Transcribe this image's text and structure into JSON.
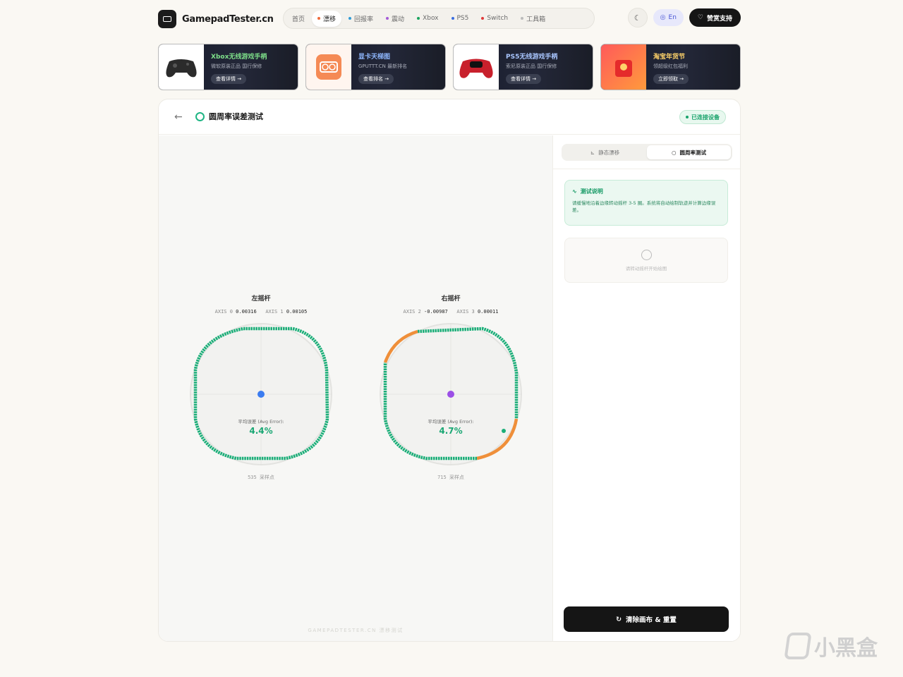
{
  "site": {
    "name": "GamepadTester.cn"
  },
  "nav": {
    "items": [
      {
        "label": "首页",
        "dot": ""
      },
      {
        "label": "漂移",
        "dot": "#f06a3a",
        "active": true
      },
      {
        "label": "回报率",
        "dot": "#2f9bd6"
      },
      {
        "label": "震动",
        "dot": "#a45bd8"
      },
      {
        "label": "Xbox",
        "dot": "#1aa55e"
      },
      {
        "label": "PS5",
        "dot": "#3a6ee0"
      },
      {
        "label": "Switch",
        "dot": "#e03a3a"
      },
      {
        "label": "工具箱",
        "dot": "#bbbbbb"
      }
    ],
    "lang": "En",
    "support": "赞赏支持"
  },
  "ads": [
    {
      "title": "Xbox无线游戏手柄",
      "sub": "微软原装正品 国行保修",
      "btn": "查看详情 →",
      "title_color": "#7ee08a"
    },
    {
      "title": "显卡天梯图",
      "sub": "GPUTTT.CN 最新排名",
      "btn": "查看排名 →",
      "title_color": "#8fb8ff"
    },
    {
      "title": "PS5无线游戏手柄",
      "sub": "索尼原装正品 国行保修",
      "btn": "查看详情 →",
      "title_color": "#a9c6ff"
    },
    {
      "title": "淘宝年货节",
      "sub": "领超级红包福利",
      "btn": "立即领取 →",
      "title_color": "#ffd36a"
    }
  ],
  "page": {
    "title": "圆周率误差测试",
    "status": "已连接设备"
  },
  "left_stick": {
    "title": "左摇杆",
    "axis_a_label": "AXIS 0",
    "axis_a_value": "0.00316",
    "axis_b_label": "AXIS 1",
    "axis_b_value": "0.00105",
    "avg_label": "平均误差 (Avg Error):",
    "avg_value": "4.4%",
    "samples": "535 采样点",
    "dot_color": "#3b7cf0"
  },
  "right_stick": {
    "title": "右摇杆",
    "axis_a_label": "AXIS 2",
    "axis_a_value": "-0.00987",
    "axis_b_label": "AXIS 3",
    "axis_b_value": "0.00011",
    "avg_label": "平均误差 (Avg Error):",
    "avg_value": "4.7%",
    "samples": "715 采样点",
    "dot_color": "#9b4fe6"
  },
  "watermark": "GAMEPADTESTER.CN 漂移测试",
  "side": {
    "tabs": [
      {
        "label": "静态漂移",
        "active": false
      },
      {
        "label": "圆周率测试",
        "active": true
      }
    ],
    "info_title": "测试说明",
    "info_text": "请缓慢地沿着边缘转动摇杆 3-5 圈。系统将自动绘制轨迹并计算边缘误差。",
    "empty_text": "请转动摇杆开始绘图",
    "reset_label": "清除画布 & 重置"
  },
  "colors": {
    "trace_good": "#1aae78",
    "trace_bad": "#ef8f3a"
  },
  "brand_overlay": "小黑盒"
}
